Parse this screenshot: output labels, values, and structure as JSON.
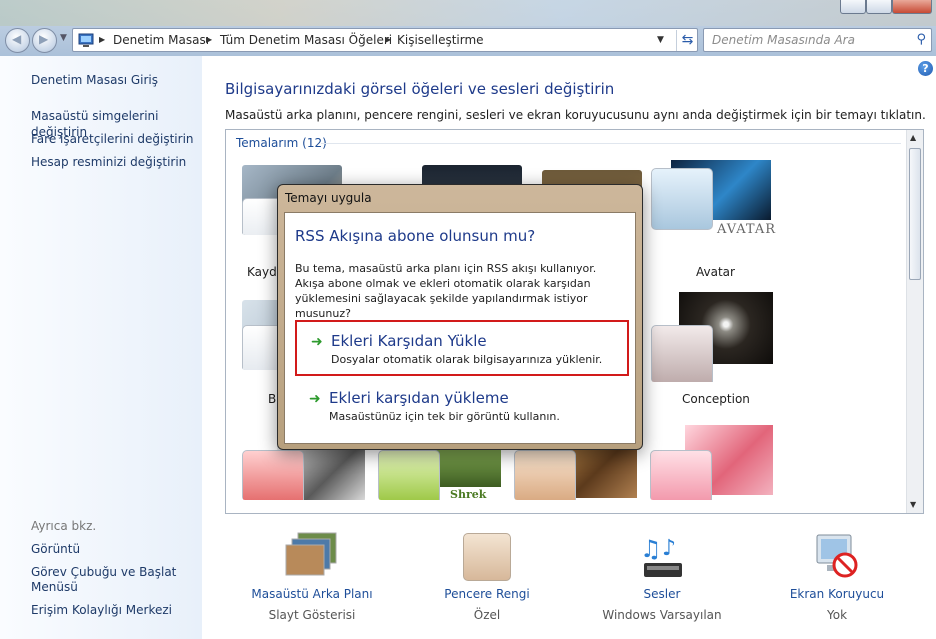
{
  "window": {
    "nav": {
      "breadcrumbs": [
        "Denetim Masası",
        "Tüm Denetim Masası Öğeleri",
        "Kişiselleştirme"
      ],
      "search_placeholder": "Denetim Masasında Ara"
    }
  },
  "sidebar": {
    "home": "Denetim Masası Giriş",
    "links": [
      "Masaüstü simgelerini değiştirin",
      "Fare işaretçilerini değiştirin",
      "Hesap resminizi değiştirin"
    ],
    "see_also_title": "Ayrıca bkz.",
    "see_also": [
      "Görüntü",
      "Görev Çubuğu ve Başlat",
      "Menüsü",
      "Erişim Kolaylığı Merkezi"
    ]
  },
  "main": {
    "title": "Bilgisayarınızdaki görsel öğeleri ve sesleri değiştirin",
    "description": "Masaüstü arka planını, pencere rengini, sesleri ve ekran koruyucusunu aynı anda değiştirmek için bir temayı tıklatın.",
    "group_label": "Temalarım (12)",
    "theme_labels": {
      "t1": "Kayde",
      "t2": "Avatar",
      "t3": "Bi",
      "t4": "Conception"
    },
    "avatar_logo": "AVATAR",
    "shrek_logo": "Shrek"
  },
  "bottom": {
    "items": [
      {
        "label": "Masaüstü Arka Planı",
        "sub": "Slayt Gösterisi"
      },
      {
        "label": "Pencere Rengi",
        "sub": "Özel"
      },
      {
        "label": "Sesler",
        "sub": "Windows Varsayılan"
      },
      {
        "label": "Ekran Koruyucu",
        "sub": "Yok"
      }
    ]
  },
  "dialog": {
    "title": "Temayı uygula",
    "question": "RSS Akışına abone olunsun mu?",
    "text": "Bu tema, masaüstü arka planı için RSS akışı kullanıyor. Akışa abone olmak ve ekleri otomatik olarak karşıdan yüklemesini sağlayacak şekilde yapılandırmak istiyor musunuz?",
    "options": [
      {
        "title": "Ekleri Karşıdan Yükle",
        "sub": "Dosyalar otomatik olarak bilgisayarınıza yüklenir."
      },
      {
        "title": "Ekleri karşıdan yükleme",
        "sub": "Masaüstünüz için tek bir görüntü kullanın."
      }
    ]
  }
}
